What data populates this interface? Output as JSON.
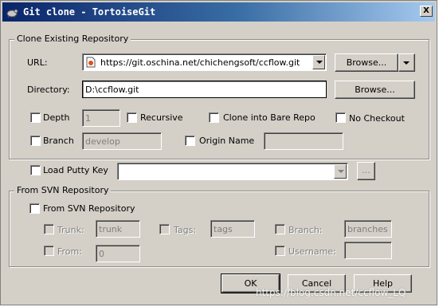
{
  "window": {
    "title": "Git clone - TortoiseGit",
    "close_label": "X"
  },
  "clone": {
    "legend": "Clone Existing Repository",
    "url_label": "URL:",
    "url_value": "https://git.oschina.net/chichengsoft/ccflow.git",
    "url_browse": "Browse...",
    "dir_label": "Directory:",
    "dir_value": "D:\\ccflow.git",
    "dir_browse": "Browse...",
    "depth_label": "Depth",
    "depth_value": "1",
    "recursive_label": "Recursive",
    "bare_label": "Clone into Bare Repo",
    "nocheckout_label": "No Checkout",
    "branch_label": "Branch",
    "branch_value": "develop",
    "origin_label": "Origin Name",
    "origin_value": ""
  },
  "putty": {
    "label": "Load Putty Key",
    "value": "",
    "browse": "..."
  },
  "svn": {
    "legend": "From SVN Repository",
    "enable_label": "From SVN Repository",
    "trunk_label": "Trunk:",
    "trunk_value": "trunk",
    "tags_label": "Tags:",
    "tags_value": "tags",
    "branch_label": "Branch:",
    "branch_value": "branches",
    "from_label": "From:",
    "from_value": "0",
    "username_label": "Username:",
    "username_value": ""
  },
  "buttons": {
    "ok": "OK",
    "cancel": "Cancel",
    "help": "Help"
  },
  "watermark": "https://blog.csdn.net/ccflow_LQ"
}
